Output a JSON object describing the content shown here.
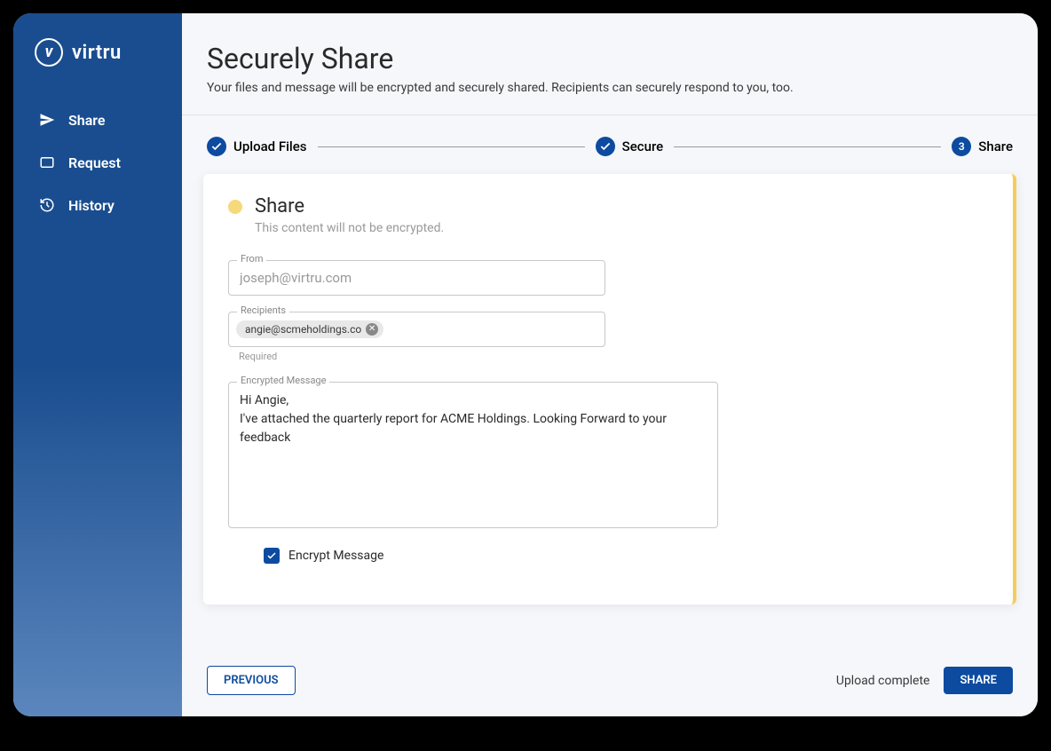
{
  "brand": {
    "name": "virtru"
  },
  "sidebar": {
    "items": [
      {
        "label": "Share"
      },
      {
        "label": "Request"
      },
      {
        "label": "History"
      }
    ]
  },
  "header": {
    "title": "Securely Share",
    "subtitle": "Your files and message will be encrypted and securely shared. Recipients can securely respond to you, too."
  },
  "stepper": {
    "steps": [
      {
        "label": "Upload Files",
        "state": "done"
      },
      {
        "label": "Secure",
        "state": "done"
      },
      {
        "label": "Share",
        "state": "current",
        "number": "3"
      }
    ]
  },
  "card": {
    "title": "Share",
    "subtitle": "This content will not be encrypted."
  },
  "form": {
    "from_label": "From",
    "from_value": "joseph@virtru.com",
    "recipients_label": "Recipients",
    "recipients": [
      {
        "email": "angie@scmeholdings.co"
      }
    ],
    "recipients_helper": "Required",
    "message_label": "Encrypted Message",
    "message_value": "Hi Angie,\nI've attached the quarterly report for ACME Holdings. Looking Forward to your feedback",
    "encrypt_checkbox": {
      "label": "Encrypt Message",
      "checked": true
    }
  },
  "footer": {
    "previous_label": "PREVIOUS",
    "status": "Upload complete",
    "share_label": "SHARE"
  }
}
